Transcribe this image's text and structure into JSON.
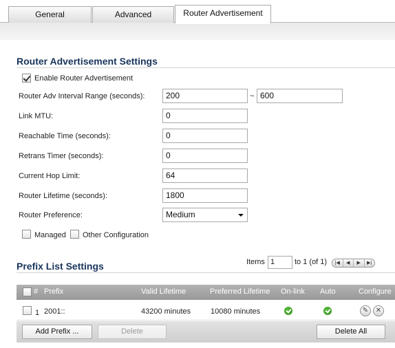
{
  "tabs": [
    {
      "label": "General"
    },
    {
      "label": "Advanced"
    },
    {
      "label": "Router Advertisement"
    }
  ],
  "ra_settings": {
    "title": "Router Advertisement Settings",
    "enable_label": "Enable Router Advertisement",
    "enable_checked": true,
    "interval_label": "Router Adv Interval Range (seconds):",
    "interval_min": "200",
    "interval_sep": "~",
    "interval_max": "600",
    "mtu_label": "Link MTU:",
    "mtu_value": "0",
    "reachable_label": "Reachable Time (seconds):",
    "reachable_value": "0",
    "retrans_label": "Retrans Timer (seconds):",
    "retrans_value": "0",
    "hop_label": "Current Hop Limit:",
    "hop_value": "64",
    "lifetime_label": "Router Lifetime (seconds):",
    "lifetime_value": "1800",
    "preference_label": "Router Preference:",
    "preference_value": "Medium",
    "managed_label": "Managed",
    "other_config_label": "Other Configuration"
  },
  "prefix_list": {
    "title": "Prefix List Settings",
    "pager": {
      "items_label": "Items",
      "start": "1",
      "range_text": "to 1 (of 1)"
    },
    "headers": {
      "index": "#",
      "prefix": "Prefix",
      "valid": "Valid Lifetime",
      "preferred": "Preferred Lifetime",
      "onlink": "On-link",
      "auto": "Auto",
      "configure": "Configure"
    },
    "rows": [
      {
        "index": "1",
        "prefix": "2001::",
        "valid": "43200 minutes",
        "preferred": "10080 minutes"
      }
    ],
    "buttons": {
      "add": "Add Prefix ...",
      "delete": "Delete",
      "delete_all": "Delete All"
    }
  }
}
